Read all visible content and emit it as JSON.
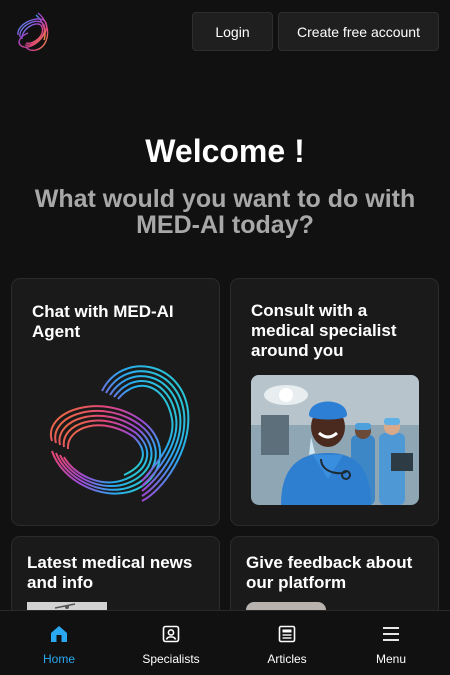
{
  "header": {
    "login_label": "Login",
    "create_account_label": "Create free account"
  },
  "hero": {
    "title": "Welcome !",
    "subtitle": "What would you want to do with MED-AI today?"
  },
  "cards": [
    {
      "title": "Chat with MED-AI Agent",
      "icon": "ribbon-logo-art"
    },
    {
      "title": "Consult with a medical specialist around you",
      "icon": "surgeon-photo"
    },
    {
      "title": "Latest medical news and info",
      "icon": "news-thumbnail"
    },
    {
      "title": "Give feedback about our platform",
      "icon": "feedback-thumbnail"
    }
  ],
  "nav": {
    "items": [
      {
        "label": "Home",
        "icon": "home-icon",
        "active": true
      },
      {
        "label": "Specialists",
        "icon": "specialist-badge-icon",
        "active": false
      },
      {
        "label": "Articles",
        "icon": "article-icon",
        "active": false
      },
      {
        "label": "Menu",
        "icon": "hamburger-menu-icon",
        "active": false
      }
    ]
  },
  "colors": {
    "background": "#111111",
    "card": "#1a1a1a",
    "accent": "#29a8f0",
    "subtitle": "#a8a8a8"
  }
}
